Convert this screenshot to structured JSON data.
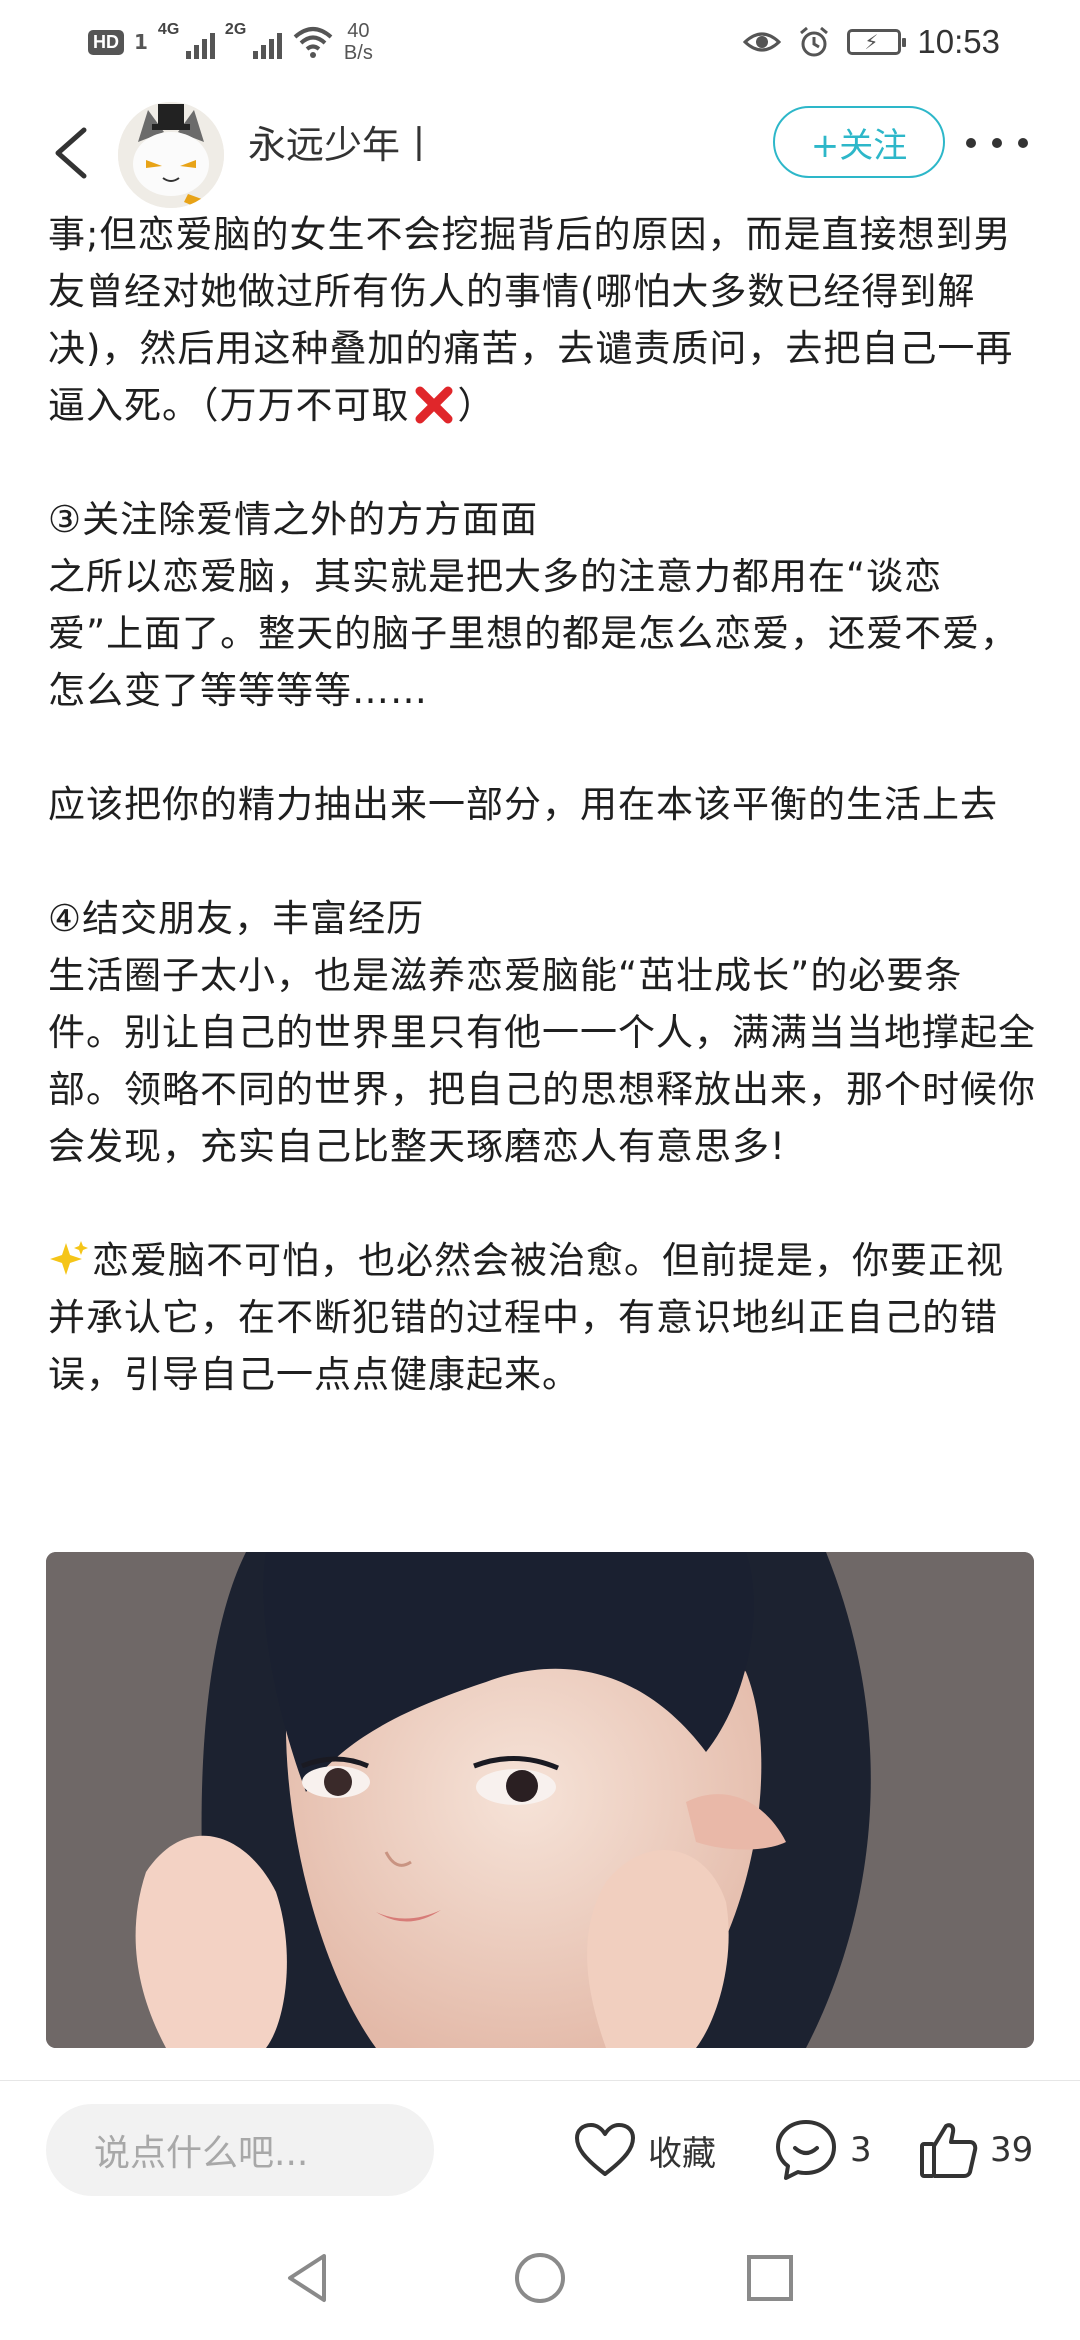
{
  "status_bar": {
    "hd": "HD",
    "sim": "1",
    "net1": "4G",
    "net2": "2G",
    "speed_value": "40",
    "speed_unit": "B/s",
    "time": "10:53"
  },
  "header": {
    "username": "永远少年丨",
    "follow_label": "+关注"
  },
  "article": {
    "p1_text": "事;但恋爱脑的女生不会挖掘背后的原因，而是直接想到男友曾经对她做过所有伤人的事情(哪怕大多数已经得到解决)，然后用这种叠加的痛苦，去谴责质问，去把自己一再逼入死。（万万不可取",
    "p1_end": "）",
    "s3_title": "③关注除爱情之外的方方面面",
    "s3_body": "之所以恋爱脑，其实就是把大多的注意力都用在“谈恋爱”上面了。整天的脑子里想的都是怎么恋爱，还爱不爱，怎么变了等等等等……",
    "s3_extra": "应该把你的精力抽出来一部分，用在本该平衡的生活上去",
    "s4_title": "④结交朋友，丰富经历",
    "s4_body": "生活圈子太小，也是滋养恋爱脑能“茁壮成长”的必要条件。别让自己的世界里只有他一一个人，满满当当地撑起全部。领略不同的世界，把自己的思想释放出来，那个时候你会发现，充实自己比整天琢磨恋人有意思多!",
    "closing": "恋爱脑不可怕，也必然会被治愈。但前提是，你要正视并承认它，在不断犯错的过程中，有意识地纠正自己的错误，引导自己一点点健康起来。"
  },
  "bottom_bar": {
    "comment_placeholder": "说点什么吧...",
    "collect_label": "收藏",
    "comment_count": "3",
    "like_count": "39"
  },
  "colors": {
    "accent": "#2db7c9",
    "text": "#1f1f1f",
    "muted": "#a8a8a8"
  },
  "icons": [
    "back-arrow-icon",
    "more-dots-icon",
    "heart-icon",
    "comment-bubble-icon",
    "thumbs-up-icon",
    "cross-mark-icon",
    "sparkles-icon",
    "nav-back-icon",
    "nav-home-icon",
    "nav-recents-icon"
  ]
}
